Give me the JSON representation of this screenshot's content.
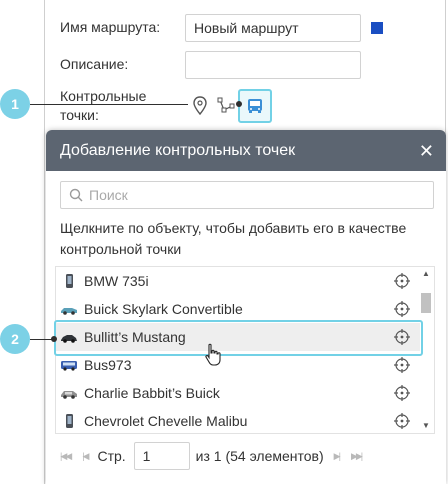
{
  "form": {
    "route_name_label": "Имя маршрута:",
    "route_name_value": "Новый маршрут",
    "route_color": "#1a4ec2",
    "description_label": "Описание:",
    "description_value": "",
    "checkpoints_label_line1": "Контрольные",
    "checkpoints_label_line2": "точки:",
    "checkpoint_buttons": [
      "geofence-pin-icon",
      "route-nodes-icon",
      "vehicle-bus-icon"
    ]
  },
  "callouts": {
    "first": "1",
    "second": "2",
    "color": "#7cd1e6"
  },
  "dialog": {
    "title": "Добавление контрольных точек",
    "close_icon": "close-icon",
    "header_color": "#5c6571",
    "search_placeholder": "Поиск",
    "hint": "Щелкните по объекту, чтобы добавить его в качестве контрольной точки",
    "units": [
      {
        "name": "BMW 735i",
        "icon": "phone-icon"
      },
      {
        "name": "Buick Skylark Convertible",
        "icon": "convertible-car-icon"
      },
      {
        "name": "Bullitt’s Mustang",
        "icon": "sports-car-icon",
        "selected": true
      },
      {
        "name": "Bus973",
        "icon": "bus-icon"
      },
      {
        "name": "Charlie Babbit’s Buick",
        "icon": "classic-car-icon"
      },
      {
        "name": "Chevrolet Chevelle Malibu",
        "icon": "phone-icon"
      }
    ],
    "pager": {
      "page_label": "Стр.",
      "page_value": "1",
      "total_text": "из 1 (54 элементов)"
    }
  }
}
